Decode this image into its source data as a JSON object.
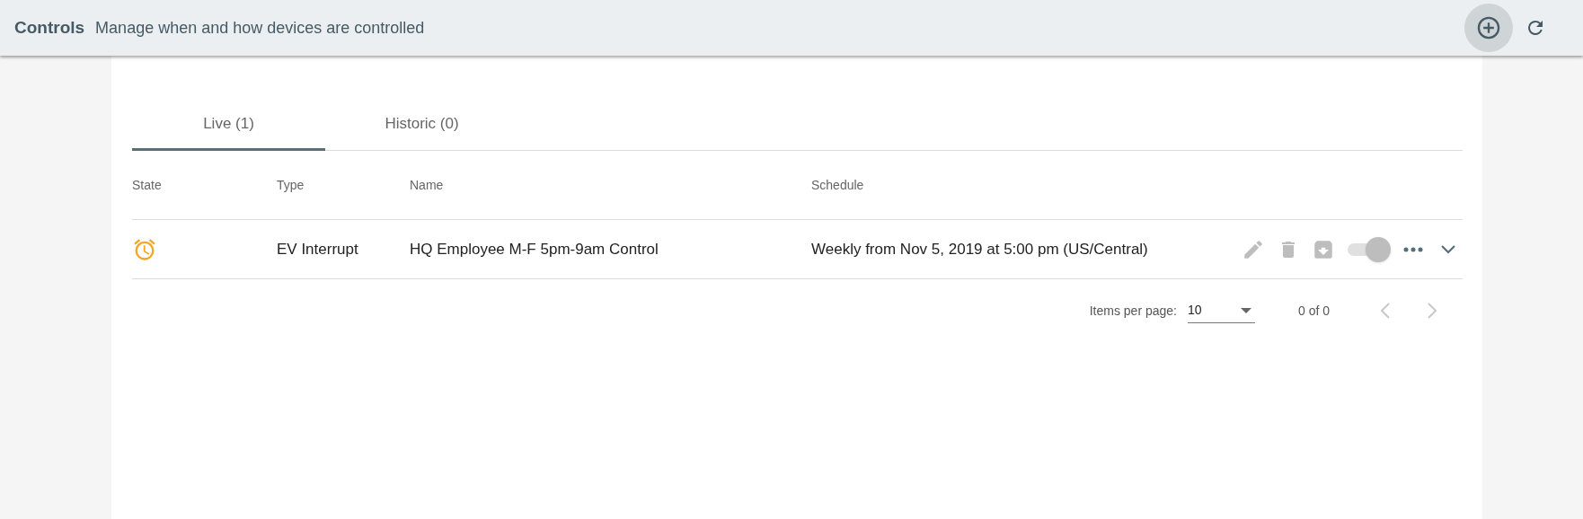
{
  "header": {
    "title": "Controls",
    "subtitle": "Manage when and how devices are controlled"
  },
  "tabs": [
    {
      "label": "Live (1)",
      "selected": true
    },
    {
      "label": "Historic (0)",
      "selected": false
    }
  ],
  "table": {
    "columns": [
      "State",
      "Type",
      "Name",
      "Schedule"
    ],
    "rows": [
      {
        "kind": "scheduled",
        "type": "EV Interrupt",
        "name": "HQ Employee M-F 5pm-9am Control",
        "schedule": "Weekly from Nov 5, 2019 at 5:00 pm (US/Central)",
        "on": true
      }
    ]
  },
  "paginator": {
    "label": "Items per page:",
    "page_size": "10",
    "range": "0 of 0"
  }
}
